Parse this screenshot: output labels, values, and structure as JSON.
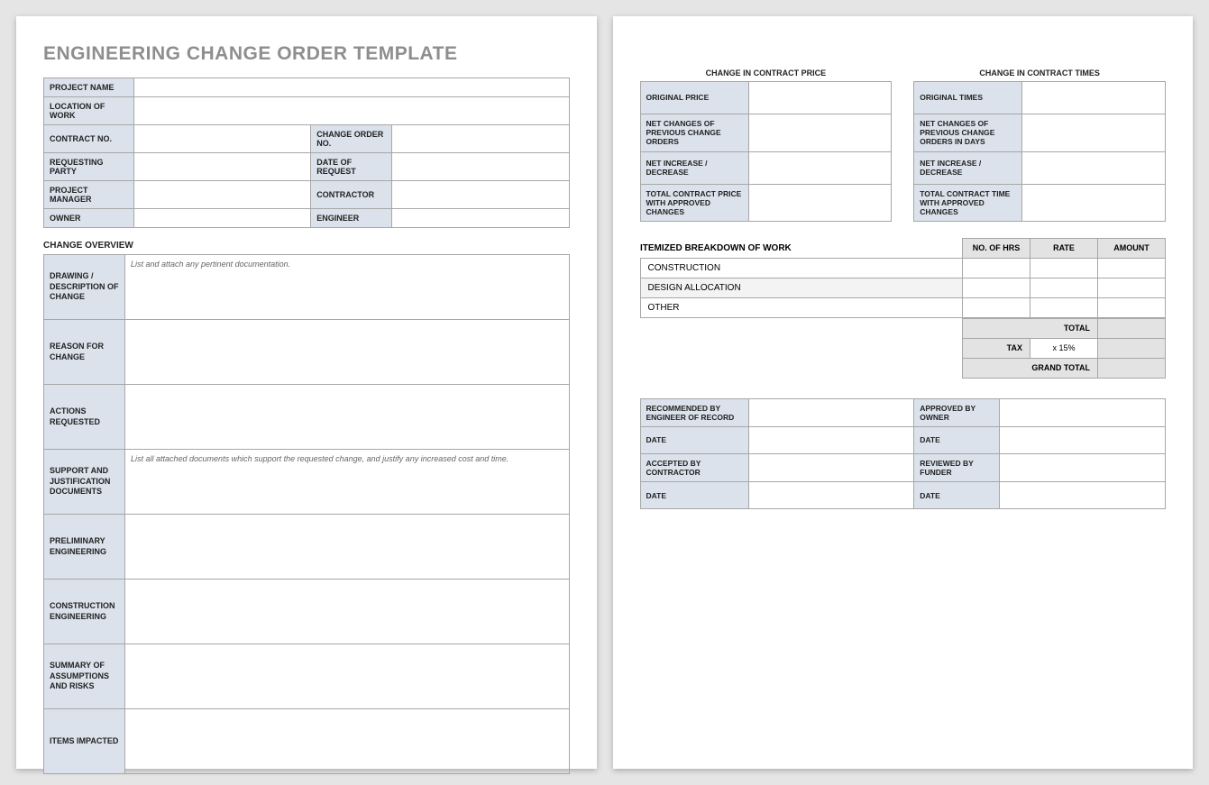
{
  "title": "ENGINEERING CHANGE ORDER TEMPLATE",
  "header_rows": [
    {
      "label": "PROJECT NAME",
      "colspan": 3
    },
    {
      "label": "LOCATION OF WORK",
      "colspan": 3
    }
  ],
  "header_pairs": [
    {
      "l": "CONTRACT NO.",
      "r": "CHANGE ORDER NO."
    },
    {
      "l": "REQUESTING PARTY",
      "r": "DATE OF REQUEST"
    },
    {
      "l": "PROJECT MANAGER",
      "r": "CONTRACTOR"
    },
    {
      "l": "OWNER",
      "r": "ENGINEER"
    }
  ],
  "overview_title": "CHANGE OVERVIEW",
  "overview": [
    {
      "label": "DRAWING / DESCRIPTION OF CHANGE",
      "hint": "List and attach any pertinent documentation."
    },
    {
      "label": "REASON FOR CHANGE",
      "hint": ""
    },
    {
      "label": "ACTIONS REQUESTED",
      "hint": ""
    },
    {
      "label": "SUPPORT AND JUSTIFICATION DOCUMENTS",
      "hint": "List all attached documents which support the requested change, and justify any increased cost and time."
    },
    {
      "label": "PRELIMINARY ENGINEERING",
      "hint": ""
    },
    {
      "label": "CONSTRUCTION ENGINEERING",
      "hint": ""
    },
    {
      "label": "SUMMARY OF ASSUMPTIONS AND RISKS",
      "hint": ""
    },
    {
      "label": "ITEMS IMPACTED",
      "hint": ""
    }
  ],
  "price_title": "CHANGE IN CONTRACT PRICE",
  "price_rows": [
    "ORIGINAL PRICE",
    "NET CHANGES OF PREVIOUS CHANGE ORDERS",
    "NET INCREASE / DECREASE",
    "TOTAL CONTRACT PRICE WITH APPROVED CHANGES"
  ],
  "times_title": "CHANGE IN CONTRACT TIMES",
  "times_rows": [
    "ORIGINAL TIMES",
    "NET CHANGES OF PREVIOUS CHANGE ORDERS IN DAYS",
    "NET INCREASE / DECREASE",
    "TOTAL CONTRACT TIME WITH APPROVED CHANGES"
  ],
  "item_title": "ITEMIZED BREAKDOWN OF WORK",
  "item_headers": [
    "NO. OF HRS",
    "RATE",
    "AMOUNT"
  ],
  "item_rows": [
    "CONSTRUCTION",
    "DESIGN ALLOCATION",
    "OTHER"
  ],
  "totals": {
    "total": "TOTAL",
    "tax": "TAX",
    "tax_val": "x 15%",
    "grand": "GRAND TOTAL"
  },
  "sign": [
    {
      "l1": "RECOMMENDED BY",
      "l2": "ENGINEER OF RECORD",
      "r1": "APPROVED BY",
      "r2": "OWNER"
    },
    {
      "l1": "DATE",
      "l2": "",
      "r1": "DATE",
      "r2": ""
    },
    {
      "l1": "ACCEPTED BY",
      "l2": "CONTRACTOR",
      "r1": "REVIEWED BY",
      "r2": "FUNDER"
    },
    {
      "l1": "DATE",
      "l2": "",
      "r1": "DATE",
      "r2": ""
    }
  ]
}
